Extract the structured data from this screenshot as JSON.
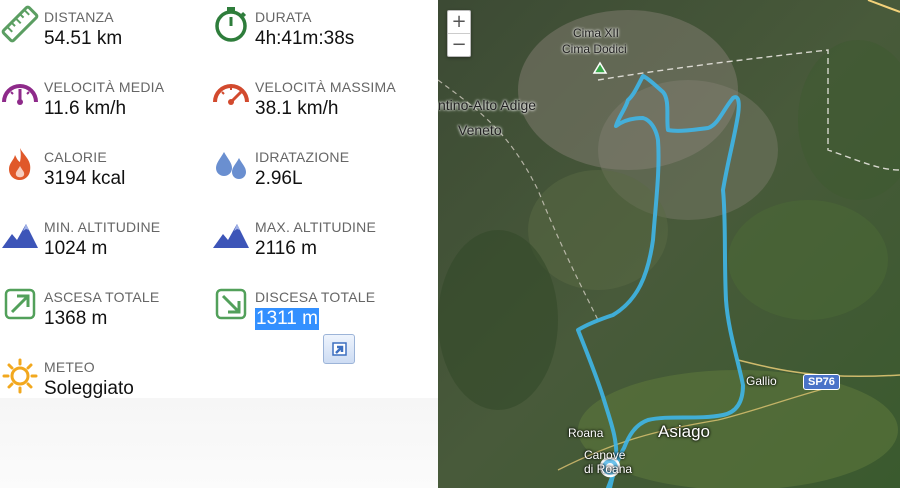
{
  "stats": [
    {
      "id": "distance",
      "icon": "ruler-icon",
      "label": "DISTANZA",
      "value": "54.51 km"
    },
    {
      "id": "duration",
      "icon": "stopwatch-icon",
      "label": "DURATA",
      "value": "4h:41m:38s"
    },
    {
      "id": "avg-speed",
      "icon": "speedometer-icon",
      "label": "VELOCITÀ MEDIA",
      "value": "11.6 km/h"
    },
    {
      "id": "max-speed",
      "icon": "speedometer-max-icon",
      "label": "VELOCITÀ MASSIMA",
      "value": "38.1 km/h"
    },
    {
      "id": "calories",
      "icon": "flame-icon",
      "label": "CALORIE",
      "value": "3194 kcal"
    },
    {
      "id": "hydration",
      "icon": "water-drops-icon",
      "label": "IDRATAZIONE",
      "value": "2.96L"
    },
    {
      "id": "min-altitude",
      "icon": "mountain-icon",
      "label": "MIN. ALTITUDINE",
      "value": "1024 m"
    },
    {
      "id": "max-altitude",
      "icon": "mountain-icon",
      "label": "MAX. ALTITUDINE",
      "value": "2116 m"
    },
    {
      "id": "ascent",
      "icon": "arrow-up-right-icon",
      "label": "ASCESA TOTALE",
      "value": "1368 m"
    },
    {
      "id": "descent",
      "icon": "arrow-down-right-icon",
      "label": "DISCESA TOTALE",
      "value": "1311 m"
    },
    {
      "id": "weather",
      "icon": "sun-icon",
      "label": "METEO",
      "value": "Soleggiato"
    }
  ],
  "colors": {
    "ruler": "#5b9e62",
    "stopwatch": "#2e7d3b",
    "speed_avg": "#8e2a8a",
    "speed_max": "#d24a2e",
    "flame": "#e0582a",
    "drops": "#6a8fd0",
    "mountain": "#3d55b8",
    "arrow": "#52a05a",
    "sun": "#f2a81e",
    "track": "#3fb6e8",
    "selection": "#3390ff"
  },
  "map": {
    "zoom_in": "+",
    "zoom_out": "−",
    "labels": {
      "peak_line1": "Cima XII",
      "peak_line2": "Cima Dodici",
      "region": "ntino-Alto Adige",
      "veneto": "Veneto",
      "gallio": "Gallio",
      "road": "SP76",
      "roana": "Roana",
      "asiago": "Asiago",
      "canove1": "Canove",
      "canove2": "di Roana"
    }
  }
}
